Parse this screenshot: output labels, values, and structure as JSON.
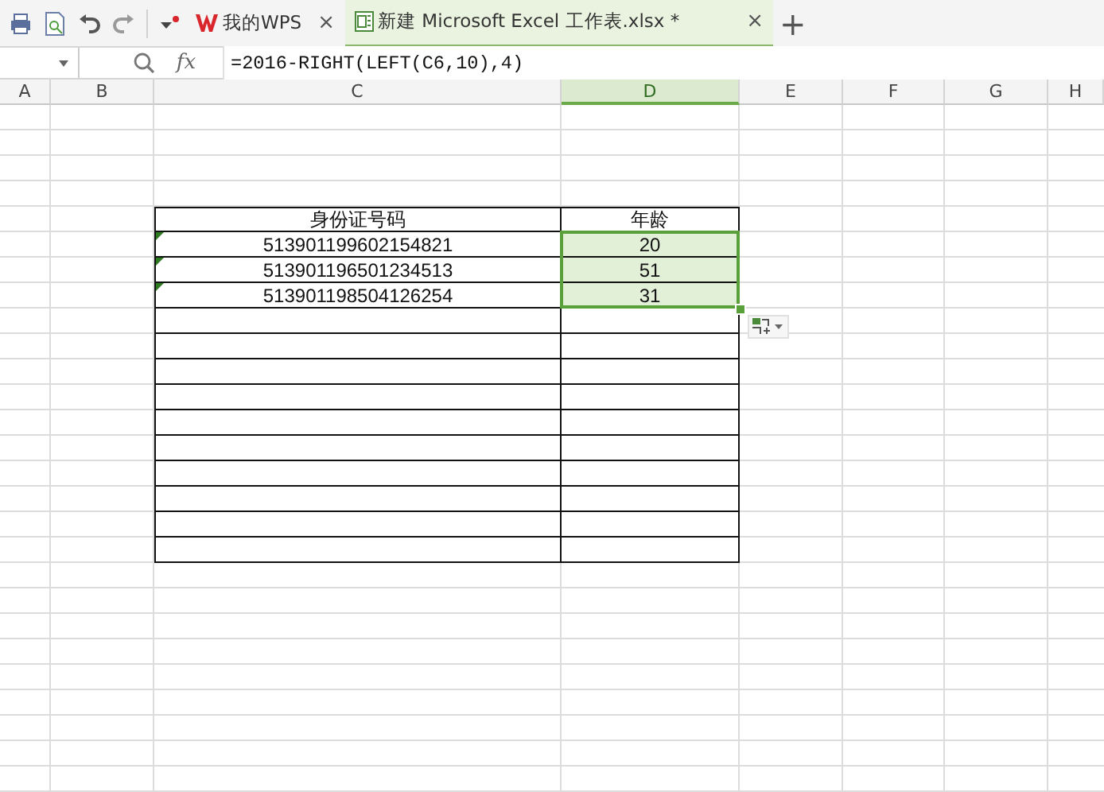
{
  "tabs": [
    {
      "kind": "home",
      "label": "我的WPS",
      "close": "×",
      "selected": false
    },
    {
      "kind": "sheet",
      "label": "新建 Microsoft Excel 工作表.xlsx *",
      "close": "×",
      "selected": true
    }
  ],
  "new_tab": "+",
  "formula_bar": {
    "fx": "fx",
    "formula": "=2016-RIGHT(LEFT(C6,10),4)"
  },
  "columns": [
    {
      "label": "A",
      "selected": false
    },
    {
      "label": "B",
      "selected": false
    },
    {
      "label": "C",
      "selected": false
    },
    {
      "label": "D",
      "selected": true
    },
    {
      "label": "E",
      "selected": false
    },
    {
      "label": "F",
      "selected": false
    },
    {
      "label": "G",
      "selected": false
    },
    {
      "label": "H",
      "selected": false
    }
  ],
  "table": {
    "headers": [
      "身份证号码",
      "年龄"
    ],
    "rows": [
      {
        "id": "513901199602154821",
        "age": "20",
        "text_flag": true,
        "selected": true
      },
      {
        "id": "513901196501234513",
        "age": "51",
        "text_flag": true,
        "selected": true
      },
      {
        "id": "513901198504126254",
        "age": "31",
        "text_flag": true,
        "selected": true
      }
    ]
  }
}
